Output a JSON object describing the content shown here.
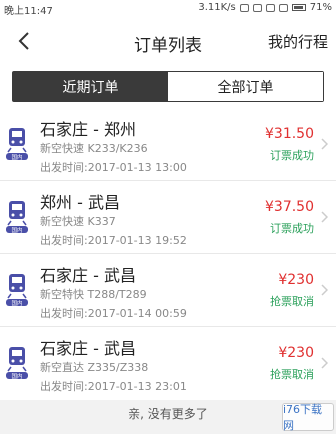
{
  "statusbar": {
    "time": "晚上11:47",
    "speed": "3.11K/s",
    "battery": "71%"
  },
  "header": {
    "title": "订单列表",
    "right_link": "我的行程"
  },
  "tabs": [
    {
      "label": "近期订单",
      "active": true
    },
    {
      "label": "全部订单",
      "active": false
    }
  ],
  "orders": [
    {
      "route": "石家庄 - 郑州",
      "train": "新空快速 K233/K236",
      "depart": "出发时间:2017-01-13 13:00",
      "price": "¥31.50",
      "status": "订票成功"
    },
    {
      "route": "郑州 - 武昌",
      "train": "新空快速 K337",
      "depart": "出发时间:2017-01-13 19:52",
      "price": "¥37.50",
      "status": "订票成功"
    },
    {
      "route": "石家庄 - 武昌",
      "train": "新空特快 T288/T289",
      "depart": "出发时间:2017-01-14 00:59",
      "price": "¥230",
      "status": "抢票取消"
    },
    {
      "route": "石家庄 - 武昌",
      "train": "新空直达 Z335/Z338",
      "depart": "出发时间:2017-01-13 23:01",
      "price": "¥230",
      "status": "抢票取消"
    }
  ],
  "icon_badge": "国内",
  "footer": "亲, 没有更多了",
  "watermark": "i76下载网",
  "colors": {
    "price": "#e03030",
    "status": "#2aa05a",
    "tab_active": "#3a3a3a",
    "icon": "#4a4fa8"
  }
}
